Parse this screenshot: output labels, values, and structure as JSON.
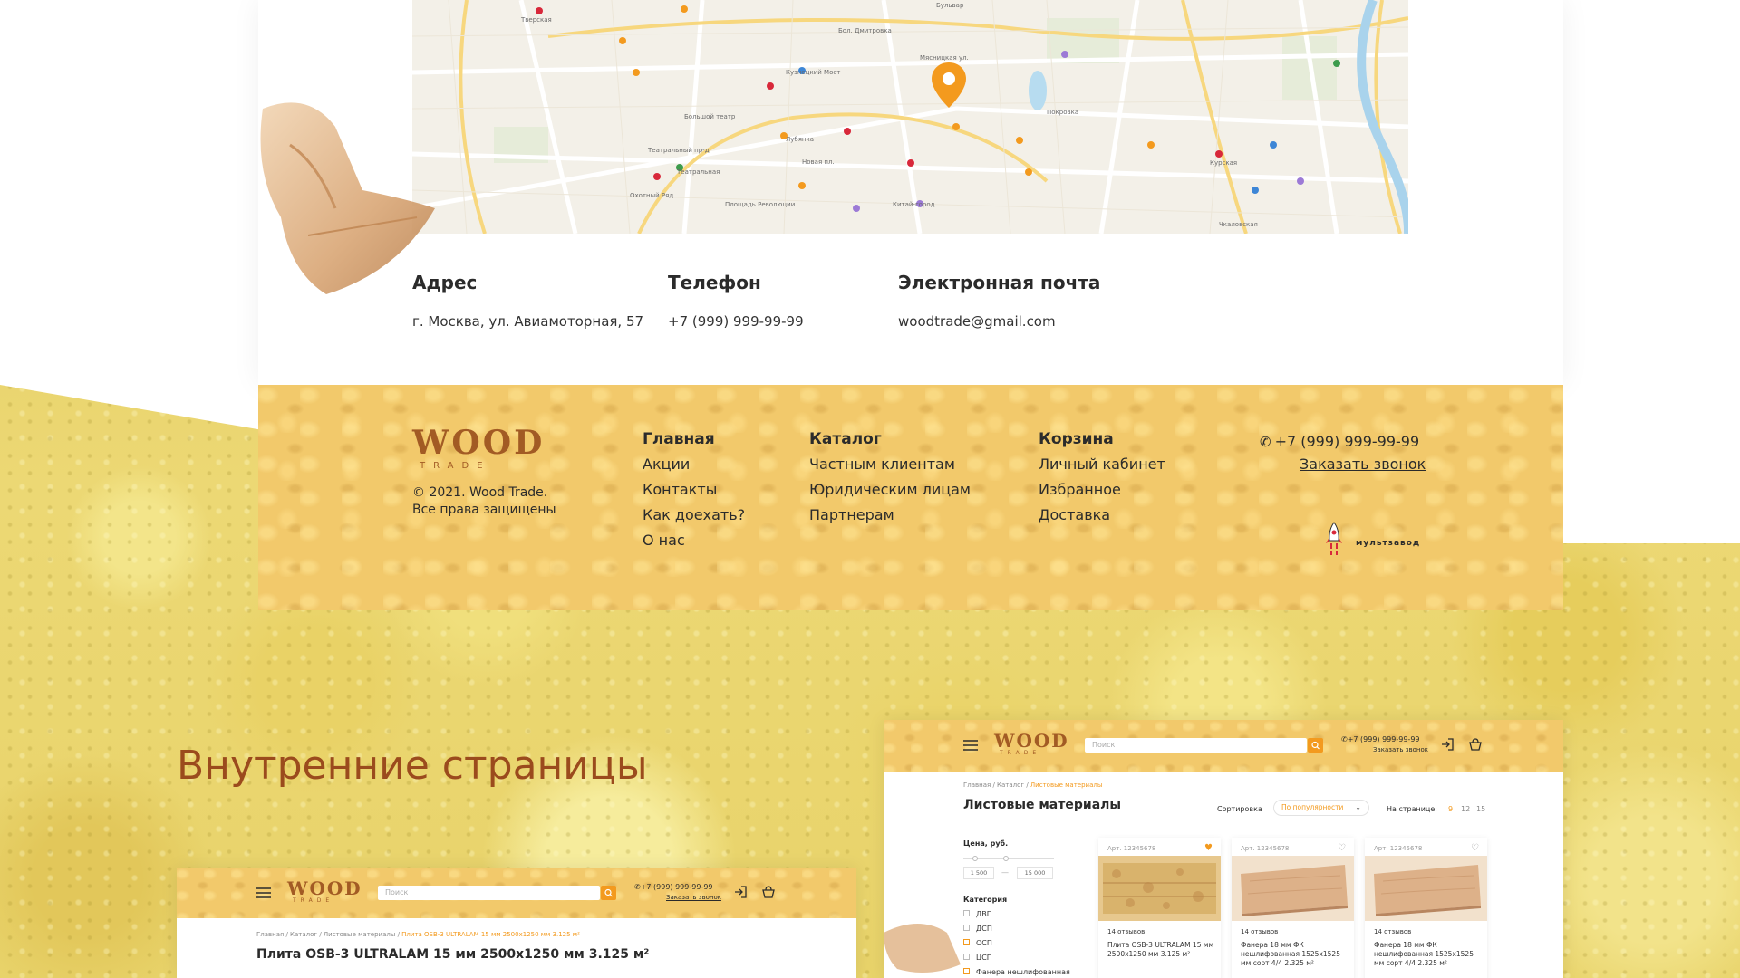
{
  "contacts": {
    "address_title": "Адрес",
    "address_value": "г. Москва, ул. Авиамоторная, 57",
    "phone_title": "Телефон",
    "phone_value": "+7 (999) 999-99-99",
    "email_title": "Электронная почта",
    "email_value": "woodtrade@gmail.com"
  },
  "map": {
    "labels": [
      "Тверская",
      "Бульвар",
      "Кузнецкий Мост",
      "Лубянка",
      "Театральная",
      "Охотный Ряд",
      "Китай-город",
      "Площадь Революции",
      "Курская",
      "Чкаловская",
      "Театральный пр-д",
      "Новая пл.",
      "Бол. Дмитровка",
      "Покровка",
      "Большой театр",
      "Мясницкая ул."
    ]
  },
  "footer": {
    "logo_word": "WOOD",
    "logo_sub": "TRADE",
    "copyright_line1": "© 2021. Wood Trade.",
    "copyright_line2": "Все права защищены",
    "col1": [
      "Главная",
      "Акции",
      "Контакты",
      "Как доехать?",
      "О нас"
    ],
    "col2": [
      "Каталог",
      "Частным клиентам",
      "Юридическим лицам",
      "Партнерам"
    ],
    "col3": [
      "Корзина",
      "Личный кабинет",
      "Избранное",
      "Доставка"
    ],
    "phone": "+7 (999) 999-99-99",
    "callback": "Заказать звонок",
    "developer": "мультзавод"
  },
  "section_title": "Внутренние страницы",
  "mini_left": {
    "search_placeholder": "Поиск",
    "phone": "+7 (999) 999-99-99",
    "callback": "Заказать звонок",
    "crumbs": "Главная / Каталог / Листовые материалы / ",
    "crumb_current": "Плита OSB-3 ULTRALAM 15 мм 2500x1250 мм 3.125 м²",
    "title": "Плита OSB-3 ULTRALAM 15 мм 2500х1250 мм 3.125 м²"
  },
  "mini_right": {
    "search_placeholder": "Поиск",
    "phone": "+7 (999) 999-99-99",
    "callback": "Заказать звонок",
    "crumbs": "Главная / Каталог / ",
    "crumb_current": "Листовые материалы",
    "title": "Листовые материалы",
    "sort_label": "Сортировка",
    "sort_value": "По популярности",
    "per_page_label": "На странице:",
    "per_page_options": [
      "9",
      "12",
      "15"
    ],
    "price_label": "Цена, руб.",
    "price_from": "1 500",
    "price_dash": "—",
    "price_to": "15 000",
    "category_label": "Категория",
    "categories": [
      "ДВП",
      "ДСП",
      "ОСП",
      "ЦСП",
      "Фанера нешлифованная"
    ],
    "cards": [
      {
        "art": "Арт. 12345678",
        "reviews": "14 отзывов",
        "title": "Плита OSB-3 ULTRALAM 15 мм 2500х1250 мм 3.125 м²"
      },
      {
        "art": "Арт. 12345678",
        "reviews": "14 отзывов",
        "title": "Фанера 18 мм ФК нешлифованная 1525х1525 мм сорт 4/4 2.325 м²"
      },
      {
        "art": "Арт. 12345678",
        "reviews": "14 отзывов",
        "title": "Фанера 18 мм ФК нешлифованная 1525х1525 мм сорт 4/4 2.325 м²"
      }
    ]
  },
  "colors": {
    "accent": "#f39a1e",
    "footer_bg": "#f2c96b",
    "brand_brown": "#a25b24",
    "title_brown": "#9b4b1d"
  }
}
